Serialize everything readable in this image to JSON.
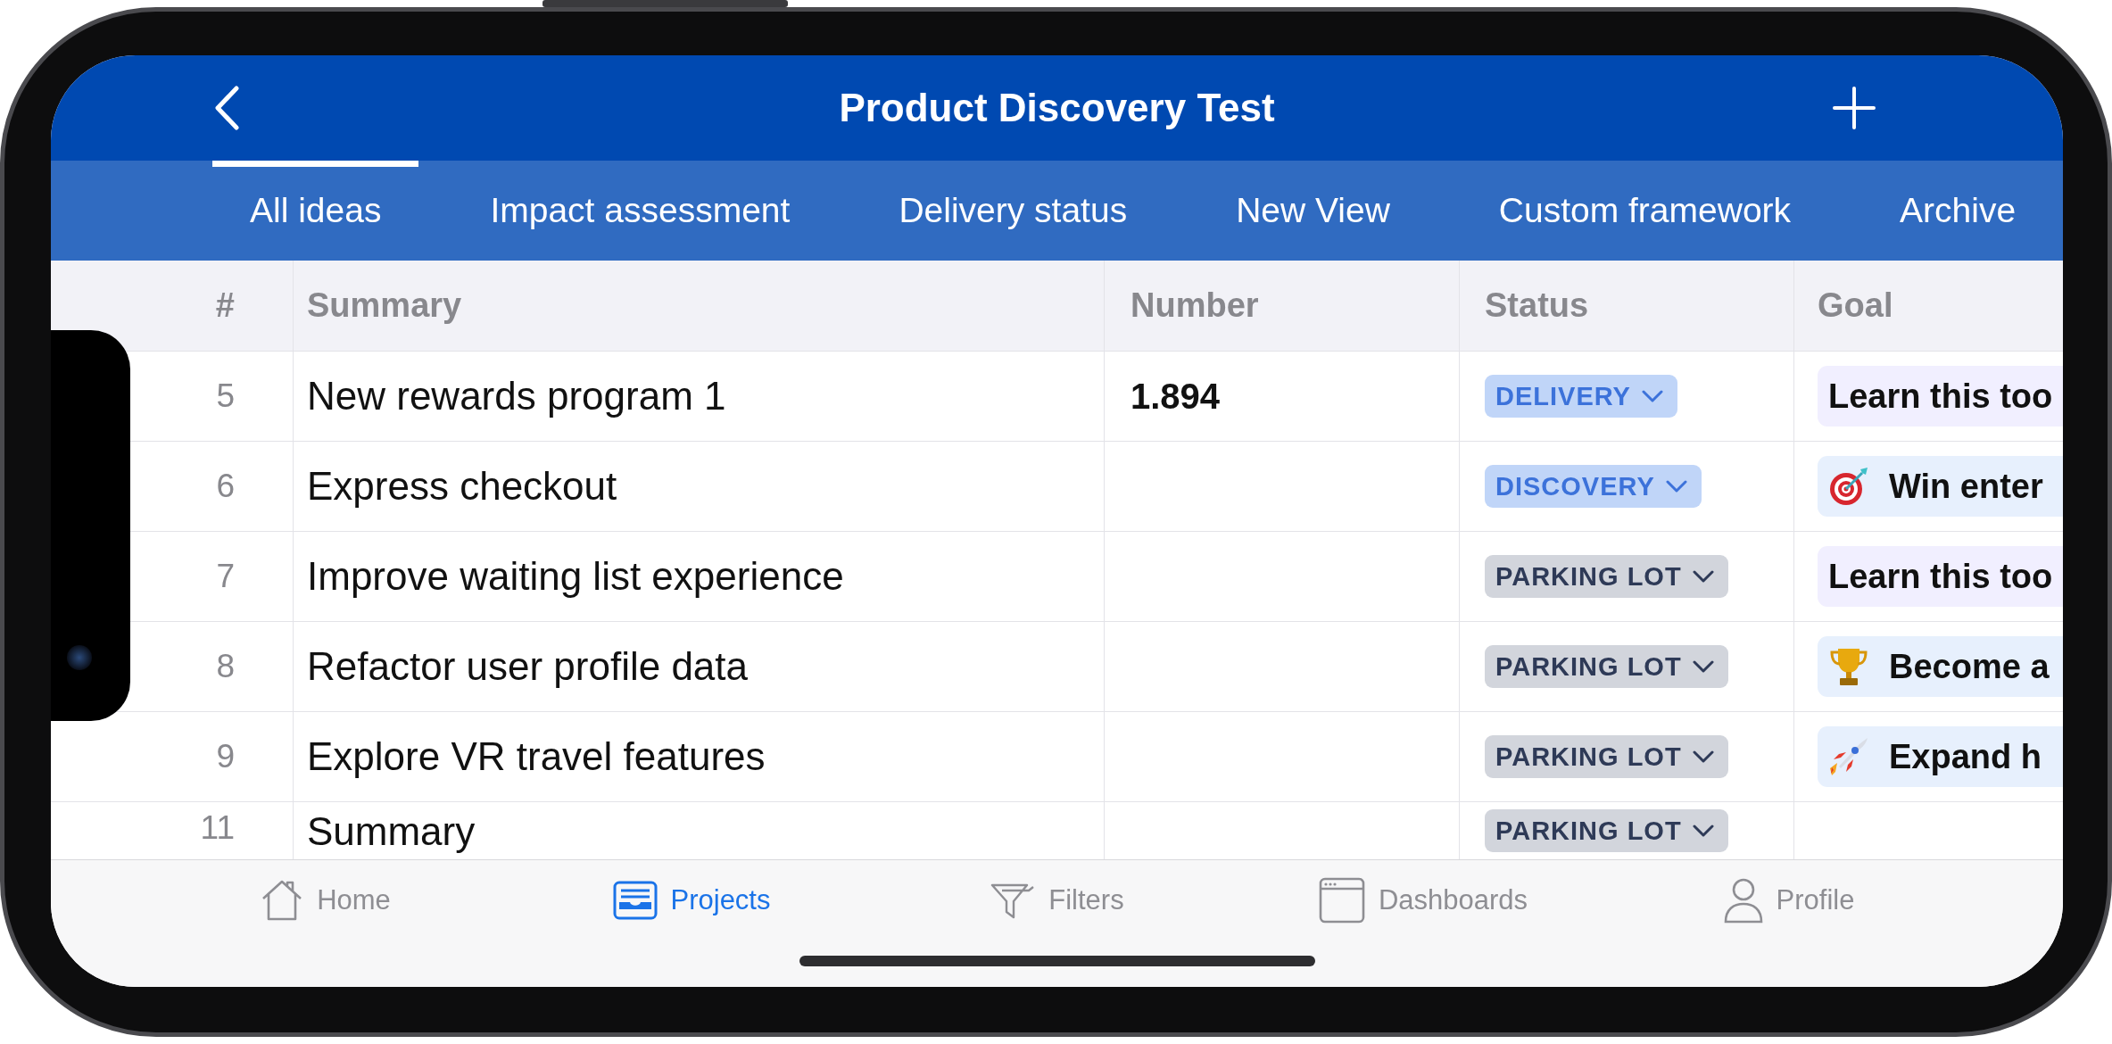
{
  "header": {
    "title": "Product Discovery Test"
  },
  "tabs": [
    {
      "label": "All ideas",
      "selected": true
    },
    {
      "label": "Impact assessment",
      "selected": false
    },
    {
      "label": "Delivery status",
      "selected": false
    },
    {
      "label": "New View",
      "selected": false
    },
    {
      "label": "Custom framework",
      "selected": false
    },
    {
      "label": "Archive",
      "selected": false
    }
  ],
  "table": {
    "columns": [
      "#",
      "Summary",
      "Number",
      "Status",
      "Goal"
    ],
    "rows": [
      {
        "index": "5",
        "summary": "New rewards program 1",
        "number": "1.894",
        "status": {
          "label": "DELIVERY",
          "color": "#c0d5f8"
        },
        "goal": {
          "label": "Learn this too",
          "color": "#f1efff"
        }
      },
      {
        "index": "6",
        "summary": "Express checkout",
        "status": {
          "label": "DISCOVERY",
          "color": "#c0d5f8"
        },
        "goal": {
          "kind": "target",
          "label": "Win enter",
          "color": "#e7f0fd"
        }
      },
      {
        "index": "7",
        "summary": "Improve waiting list experience",
        "status": {
          "label": "PARKING LOT",
          "color": "#d2d5dc"
        },
        "goal": {
          "label": "Learn this too",
          "color": "#f1efff"
        }
      },
      {
        "index": "8",
        "summary": "Refactor user profile data",
        "status": {
          "label": "PARKING LOT",
          "color": "#d2d5dc"
        },
        "goal": {
          "kind": "trophy",
          "label": "Become a",
          "color": "#e7f0fd"
        }
      },
      {
        "index": "9",
        "summary": "Explore VR travel features",
        "status": {
          "label": "PARKING LOT",
          "color": "#d2d5dc"
        },
        "goal": {
          "kind": "rocket",
          "label": "Expand h",
          "color": "#e7f0fd"
        }
      },
      {
        "index": "11",
        "summary": "Summary",
        "status": {
          "label": "PARKING LOT",
          "color": "#d2d5dc"
        }
      }
    ]
  },
  "nav": [
    {
      "label": "Home",
      "kind": "home",
      "selected": false
    },
    {
      "label": "Projects",
      "kind": "projects",
      "selected": true
    },
    {
      "label": "Filters",
      "kind": "filters",
      "selected": false
    },
    {
      "label": "Dashboards",
      "kind": "dashboards",
      "selected": false
    },
    {
      "label": "Profile",
      "kind": "profile",
      "selected": false
    }
  ]
}
